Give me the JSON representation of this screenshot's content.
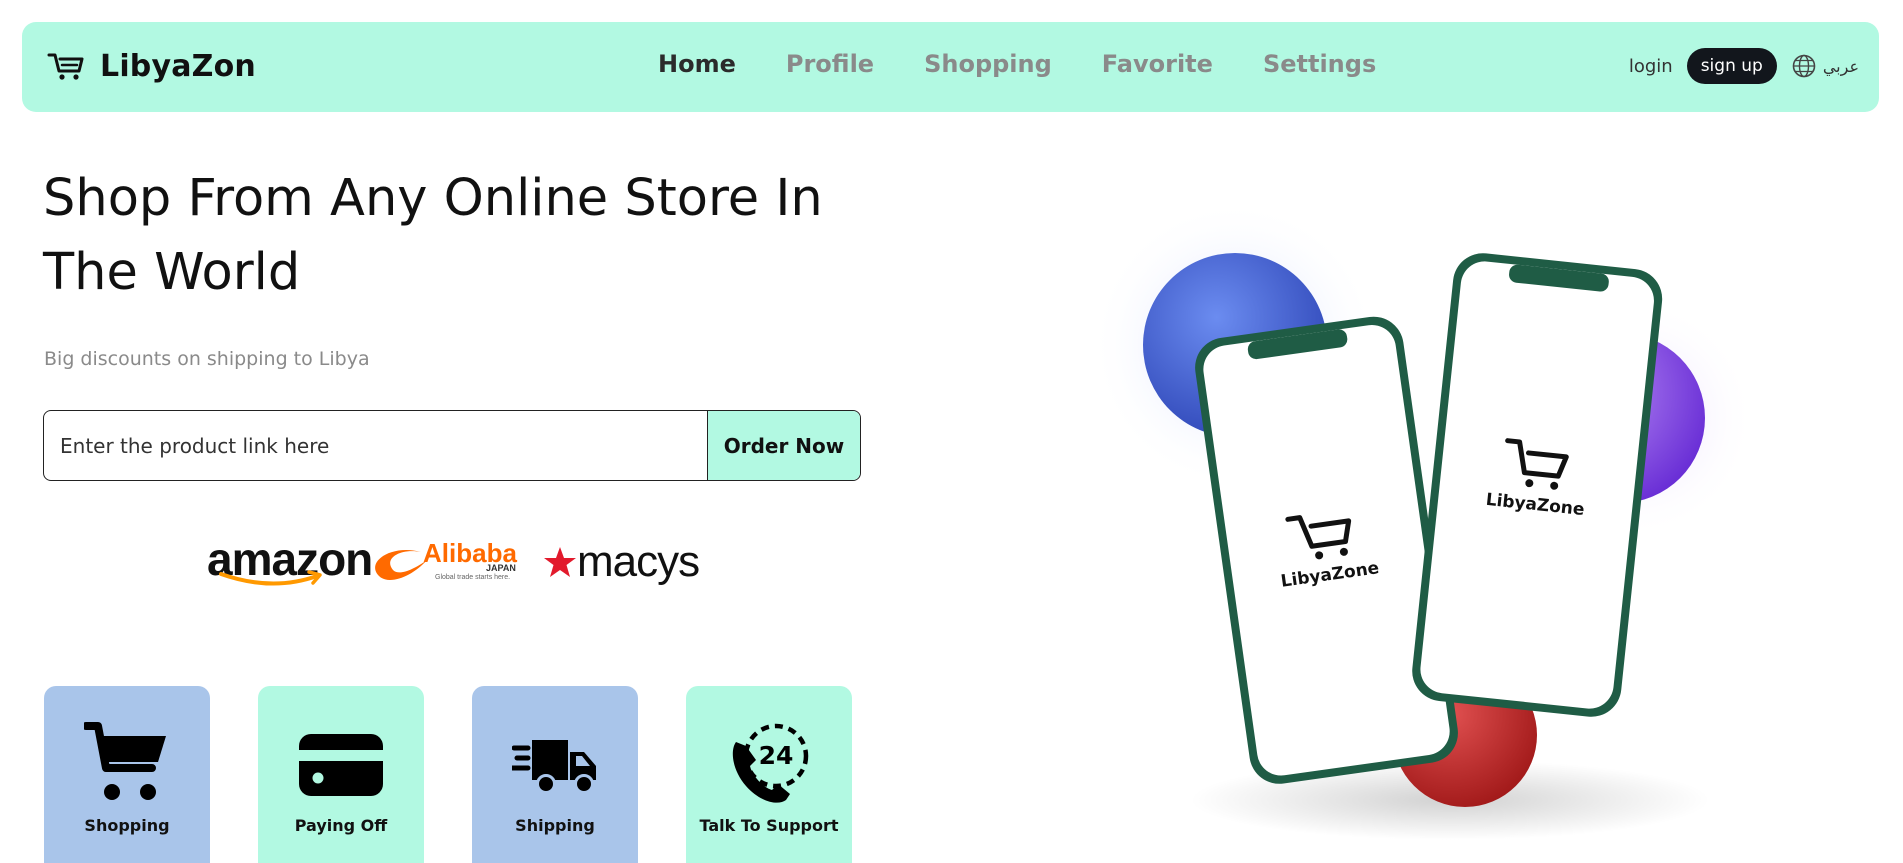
{
  "brand": {
    "name": "LibyaZon",
    "icon": "cart-icon"
  },
  "nav": {
    "items": [
      {
        "label": "Home",
        "active": true
      },
      {
        "label": "Profile",
        "active": false
      },
      {
        "label": "Shopping",
        "active": false
      },
      {
        "label": "Favorite",
        "active": false
      },
      {
        "label": "Settings",
        "active": false
      }
    ],
    "login_label": "login",
    "signup_label": "sign up",
    "language_label": "عربي",
    "language_icon": "globe-icon"
  },
  "hero": {
    "title": "Shop From Any Online Store In The World",
    "subtitle": "Big discounts on shipping to Libya",
    "input_placeholder": "Enter the product link here",
    "input_value": "",
    "order_button": "Order Now"
  },
  "stores": {
    "amazon": "amazon",
    "alibaba": {
      "name": "Alibaba",
      "region": "JAPAN",
      "tagline": "Global trade starts here."
    },
    "macys": "macys"
  },
  "features": [
    {
      "label": "Shopping",
      "icon": "shopping-cart-icon"
    },
    {
      "label": "Paying Off",
      "icon": "credit-card-icon"
    },
    {
      "label": "Shipping",
      "icon": "delivery-truck-icon"
    },
    {
      "label": "Talk To Support",
      "icon": "support-24-icon"
    }
  ],
  "illustration": {
    "phone_brand": "LibyaZone"
  },
  "colors": {
    "navbar": "#b2f9e2",
    "accent_mint": "#b2f9e2",
    "card_blue": "#a9c5ea",
    "signup_bg": "#12161c",
    "phone_frame": "#1f5c45"
  }
}
